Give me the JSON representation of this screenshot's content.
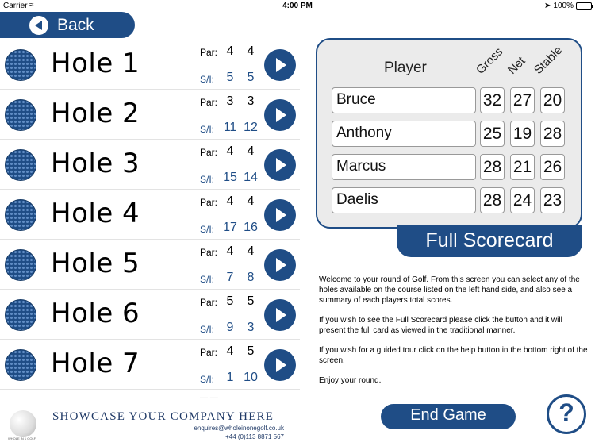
{
  "status_bar": {
    "carrier": "Carrier",
    "time": "4:00 PM",
    "battery_pct": "100%",
    "battery_level": 1.0
  },
  "nav": {
    "back_label": "Back"
  },
  "holes": [
    {
      "name": "Hole 1",
      "par_label": "Par:",
      "si_label": "S/I:",
      "par": [
        "4",
        "4"
      ],
      "si": [
        "5",
        "5"
      ]
    },
    {
      "name": "Hole 2",
      "par_label": "Par:",
      "si_label": "S/I:",
      "par": [
        "3",
        "3"
      ],
      "si": [
        "11",
        "12"
      ]
    },
    {
      "name": "Hole 3",
      "par_label": "Par:",
      "si_label": "S/I:",
      "par": [
        "4",
        "4"
      ],
      "si": [
        "15",
        "14"
      ]
    },
    {
      "name": "Hole 4",
      "par_label": "Par:",
      "si_label": "S/I:",
      "par": [
        "4",
        "4"
      ],
      "si": [
        "17",
        "16"
      ]
    },
    {
      "name": "Hole 5",
      "par_label": "Par:",
      "si_label": "S/I:",
      "par": [
        "4",
        "4"
      ],
      "si": [
        "7",
        "8"
      ]
    },
    {
      "name": "Hole 6",
      "par_label": "Par:",
      "si_label": "S/I:",
      "par": [
        "5",
        "5"
      ],
      "si": [
        "9",
        "3"
      ]
    },
    {
      "name": "Hole 7",
      "par_label": "Par:",
      "si_label": "S/I:",
      "par": [
        "4",
        "5"
      ],
      "si": [
        "1",
        "10"
      ]
    }
  ],
  "sponsor": {
    "title": "SHOWCASE YOUR COMPANY HERE",
    "email": "enquires@wholeinonegolf.co.uk",
    "phone": "+44 (0)113 8871 567",
    "logo_text": "WHOLE IN 1 GOLF"
  },
  "scoreboard": {
    "headers": {
      "player": "Player",
      "gross": "Gross",
      "net": "Net",
      "stable": "Stable"
    },
    "rows": [
      {
        "player": "Bruce",
        "gross": "32",
        "net": "27",
        "stable": "20"
      },
      {
        "player": "Anthony",
        "gross": "25",
        "net": "19",
        "stable": "28"
      },
      {
        "player": "Marcus",
        "gross": "28",
        "net": "21",
        "stable": "26"
      },
      {
        "player": "Daelis",
        "gross": "28",
        "net": "24",
        "stable": "23"
      }
    ]
  },
  "full_scorecard_label": "Full Scorecard",
  "info": {
    "p1": "Welcome to your round of Golf. From this screen you can select any of the holes available on the course listed on the left hand side, and also see a summary of each players total scores.",
    "p2": "If you wish to see the Full Scorecard please click the button and it will present the full card as viewed in the traditional manner.",
    "p3": "If you wish for a guided tour click on the help button in the bottom right of the screen.",
    "p4": "Enjoy your round."
  },
  "end_game_label": "End Game",
  "help_label": "?",
  "colors": {
    "brand_blue": "#1f4d86",
    "panel_gray": "#ebebeb"
  }
}
